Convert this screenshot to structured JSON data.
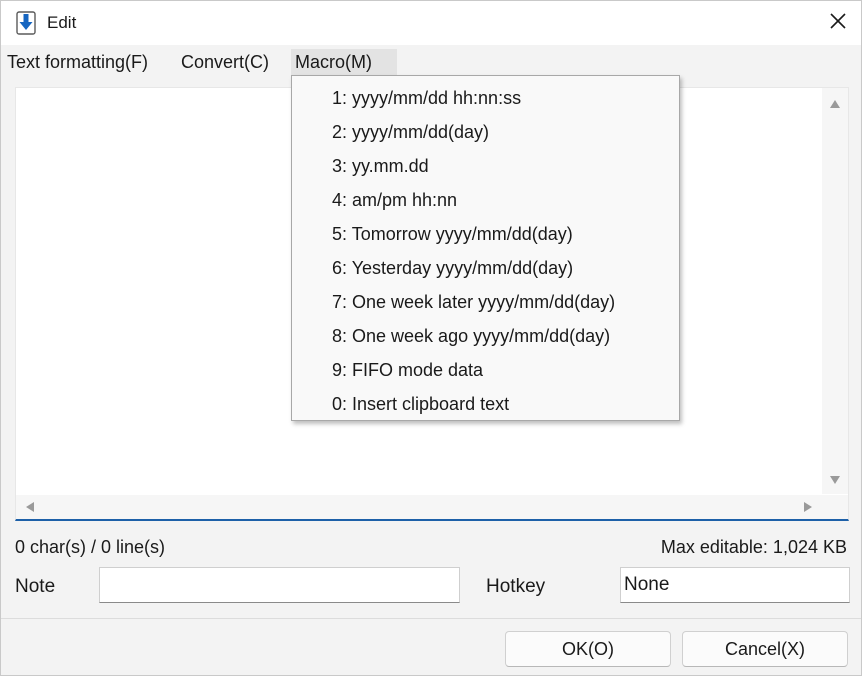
{
  "window": {
    "title": "Edit"
  },
  "menubar": {
    "items": [
      {
        "label": "Text formatting(F)"
      },
      {
        "label": "Convert(C)"
      },
      {
        "label": "Macro(M)"
      }
    ]
  },
  "macro_menu": {
    "items": [
      {
        "label": "1: yyyy/mm/dd hh:nn:ss"
      },
      {
        "label": "2: yyyy/mm/dd(day)"
      },
      {
        "label": "3: yy.mm.dd"
      },
      {
        "label": "4: am/pm hh:nn"
      },
      {
        "label": "5: Tomorrow yyyy/mm/dd(day)"
      },
      {
        "label": "6: Yesterday yyyy/mm/dd(day)"
      },
      {
        "label": "7: One week later yyyy/mm/dd(day)"
      },
      {
        "label": "8: One week ago yyyy/mm/dd(day)"
      },
      {
        "label": "9: FIFO mode data"
      },
      {
        "label": "0: Insert clipboard text"
      }
    ]
  },
  "status": {
    "counts": "0 char(s) / 0 line(s)",
    "max_editable": "Max editable: 1,024 KB"
  },
  "fields": {
    "note_label": "Note",
    "note_value": "",
    "hotkey_label": "Hotkey",
    "hotkey_value": "None"
  },
  "buttons": {
    "ok_label": "OK(O)",
    "cancel_label": "Cancel(X)"
  },
  "colors": {
    "accent": "#1d60a8",
    "icon_blue": "#1565c0"
  }
}
